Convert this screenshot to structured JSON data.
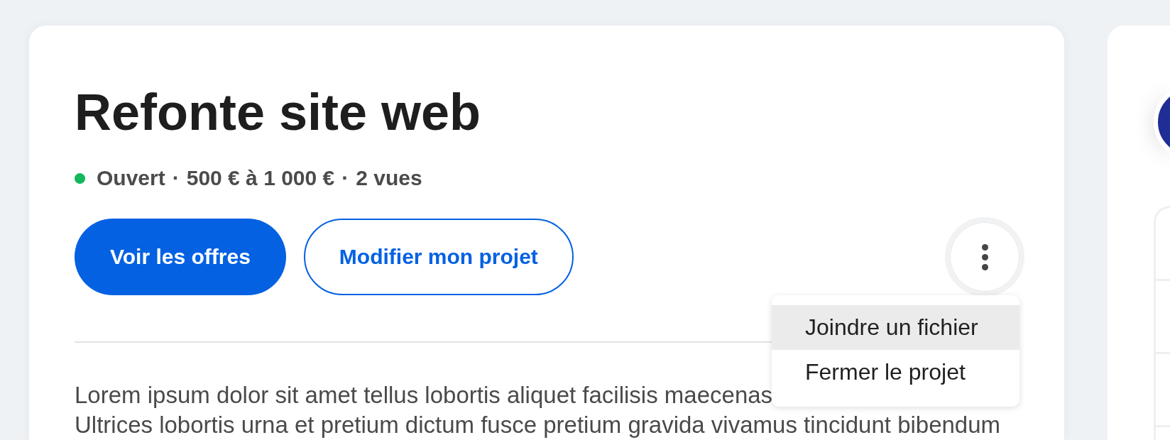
{
  "project": {
    "title": "Refonte site web",
    "meta": [
      {
        "kind": "status",
        "text": "Ouvert",
        "color": "#14b85c"
      },
      {
        "kind": "text",
        "text": "500 € à 1 000 €"
      },
      {
        "kind": "text",
        "text": "2 vues"
      }
    ],
    "meta_separator": "·",
    "actions": [
      {
        "kind": "primary",
        "label": "Voir les offres"
      },
      {
        "kind": "secondary",
        "label": "Modifier mon projet"
      }
    ],
    "more_menu": {
      "expanded": true,
      "items": [
        {
          "label": "Joindre un fichier",
          "selected": true
        },
        {
          "label": "Fermer le projet",
          "selected": false
        }
      ]
    },
    "description_lines": [
      "Lorem ipsum dolor sit amet tellus lobortis aliquet facilisis maecenas",
      "Ultrices lobortis urna et pretium dictum fusce pretium gravida vivamus tincidunt bibendum"
    ]
  }
}
